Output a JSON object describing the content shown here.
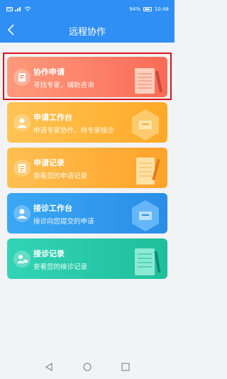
{
  "status": {
    "sim_label": "HD",
    "battery": "94%",
    "time": "10:48"
  },
  "header": {
    "title": "远程协作"
  },
  "cards": [
    {
      "title": "协作申请",
      "subtitle": "寻找专家，辅助咨询"
    },
    {
      "title": "申请工作台",
      "subtitle": "申请专家协作，待专家接诊"
    },
    {
      "title": "申请记录",
      "subtitle": "查看您的申请记录"
    },
    {
      "title": "接诊工作台",
      "subtitle": "接诊向您提交的申请"
    },
    {
      "title": "接诊记录",
      "subtitle": "查看您的接诊记录"
    }
  ]
}
